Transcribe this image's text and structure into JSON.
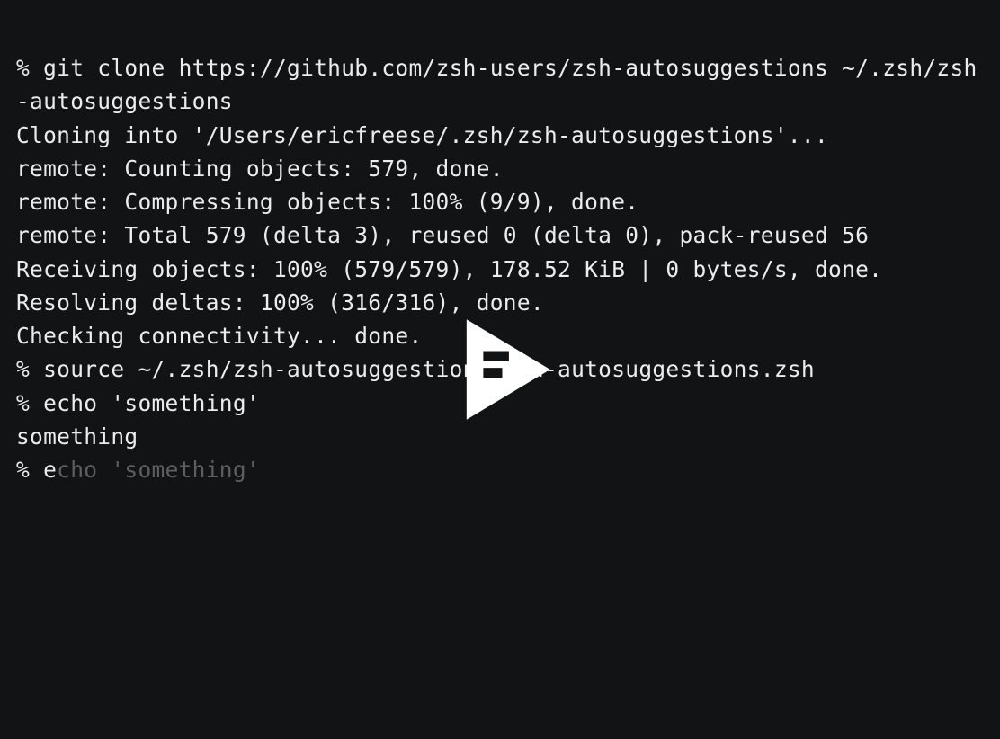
{
  "terminal": {
    "lines": [
      {
        "prompt": "% ",
        "text": "git clone https://github.com/zsh-users/zsh-autosuggestions ~/.zsh/zsh-autosuggestions"
      },
      {
        "prompt": "",
        "text": "Cloning into '/Users/ericfreese/.zsh/zsh-autosuggestions'..."
      },
      {
        "prompt": "",
        "text": "remote: Counting objects: 579, done."
      },
      {
        "prompt": "",
        "text": "remote: Compressing objects: 100% (9/9), done."
      },
      {
        "prompt": "",
        "text": "remote: Total 579 (delta 3), reused 0 (delta 0), pack-reused 56"
      },
      {
        "prompt": "",
        "text": "Receiving objects: 100% (579/579), 178.52 KiB | 0 bytes/s, done."
      },
      {
        "prompt": "",
        "text": "Resolving deltas: 100% (316/316), done."
      },
      {
        "prompt": "",
        "text": "Checking connectivity... done."
      },
      {
        "prompt": "% ",
        "text": "source ~/.zsh/zsh-autosuggestions/zsh-autosuggestions.zsh"
      },
      {
        "prompt": "% ",
        "text": "echo 'something'"
      },
      {
        "prompt": "",
        "text": "something"
      }
    ],
    "current": {
      "prompt": "% ",
      "typed": "e",
      "suggestion": "cho 'something'"
    }
  },
  "overlay": {
    "icon": "play-icon"
  },
  "colors": {
    "background": "#121314",
    "text": "#ececec",
    "suggestion": "#5f5f5f",
    "play": "#ffffff"
  }
}
